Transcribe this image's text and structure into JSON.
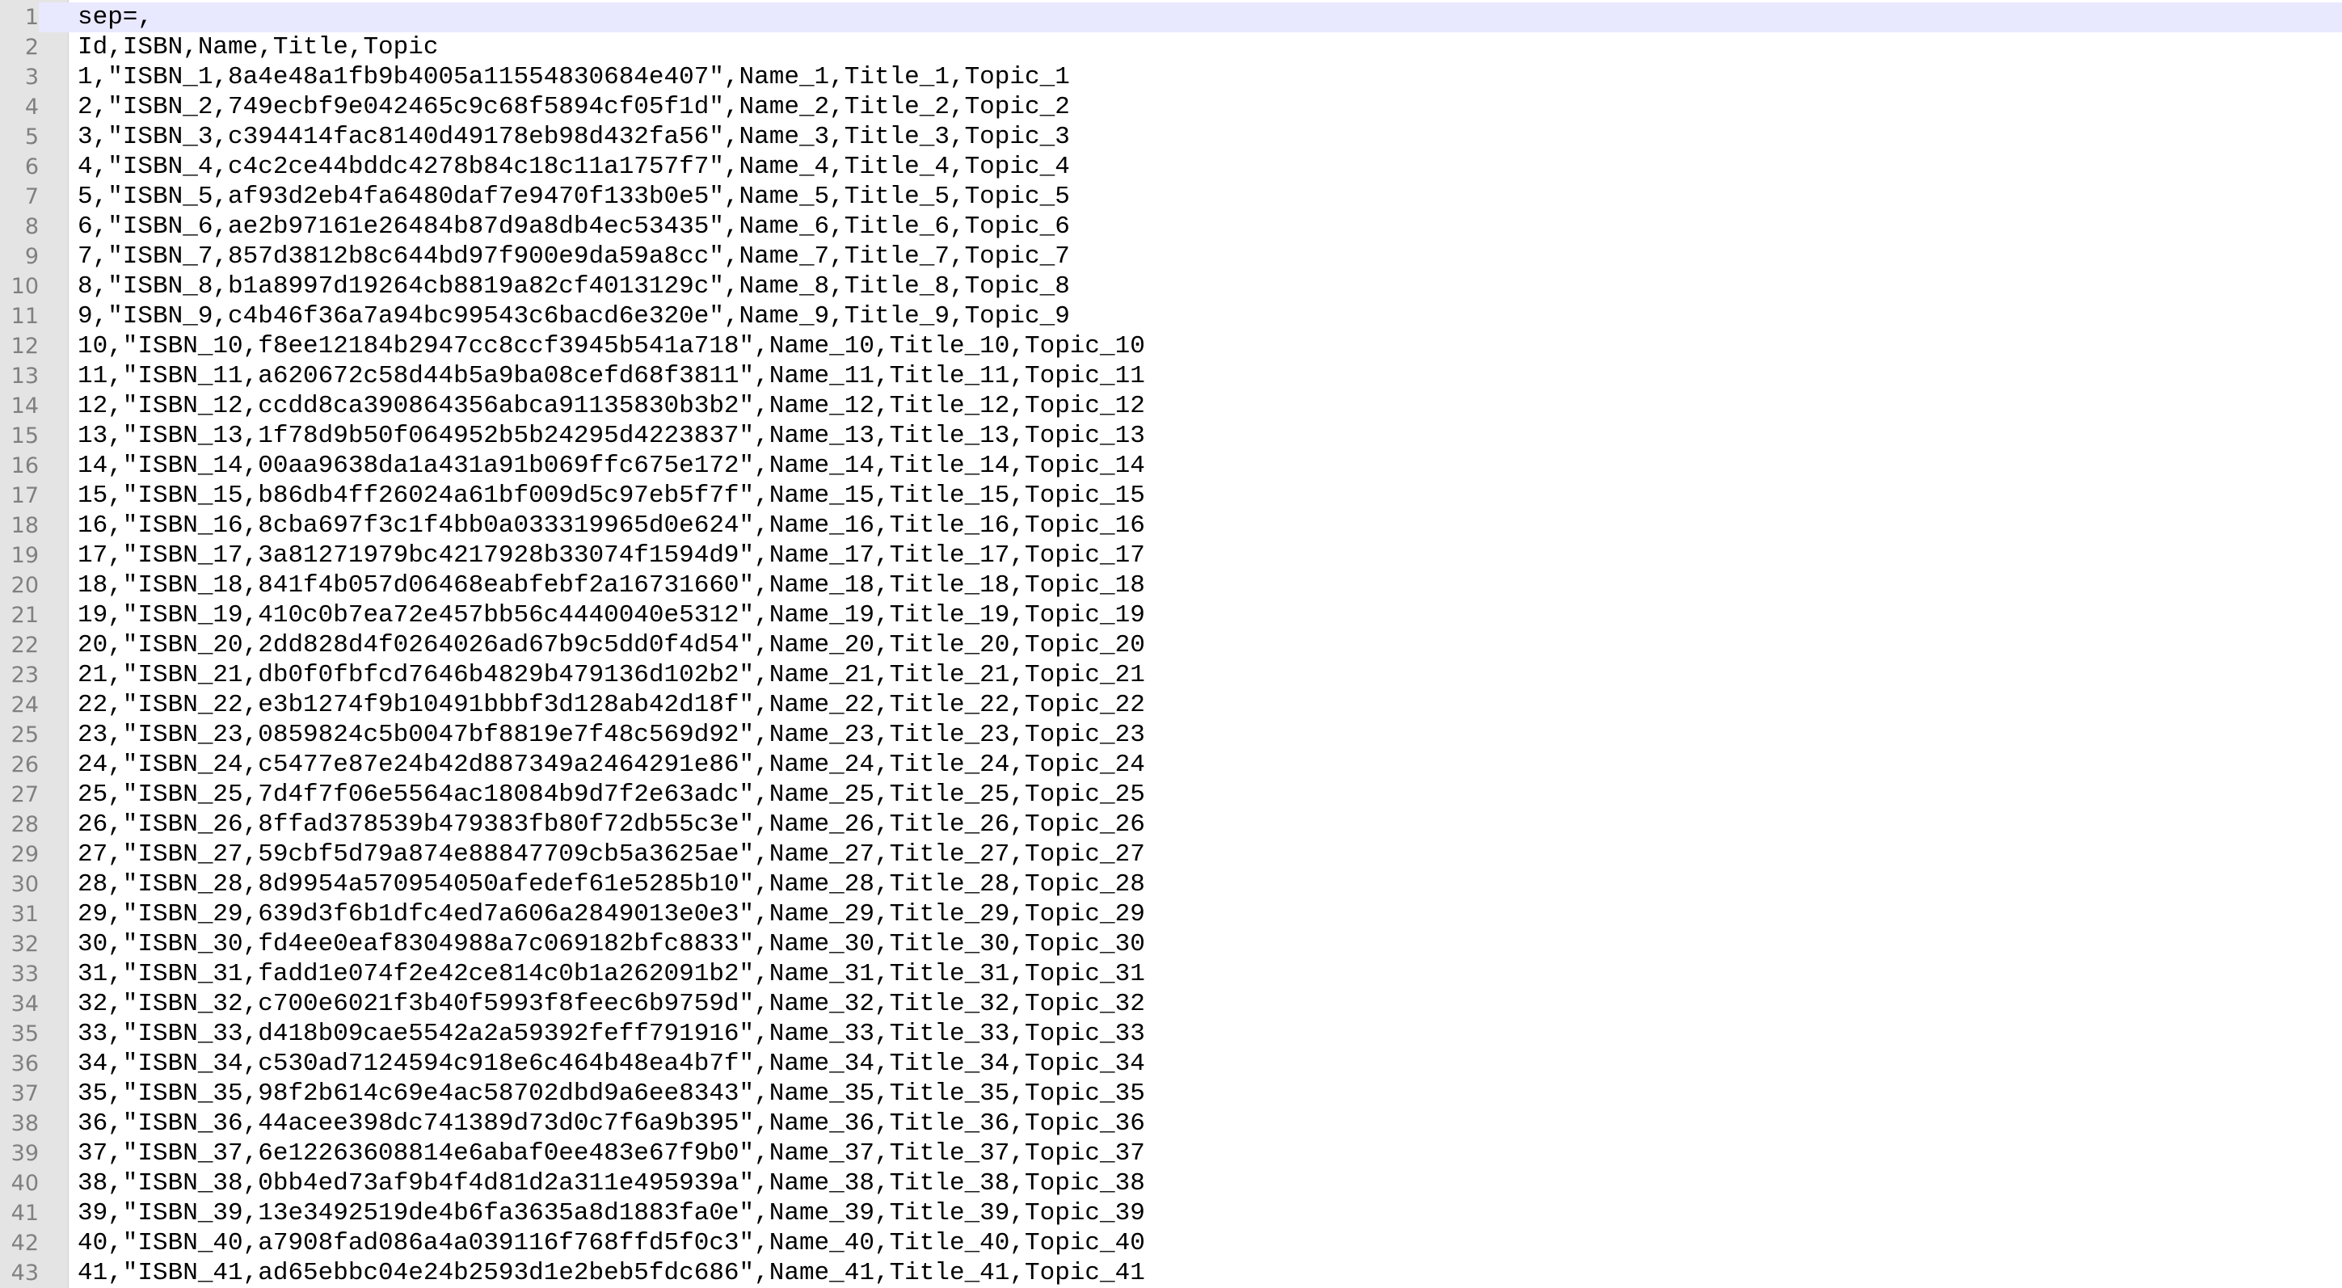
{
  "editor": {
    "current_line": 1,
    "colors": {
      "gutter_bg": "#e4e4e4",
      "current_line_bg": "#e8e8ff",
      "line_number_fg": "#808080",
      "text_fg": "#000000"
    },
    "lines": [
      {
        "n": "1",
        "text": "sep=,"
      },
      {
        "n": "2",
        "text": "Id,ISBN,Name,Title,Topic"
      },
      {
        "n": "3",
        "text": "1,\"ISBN_1,8a4e48a1fb9b4005a11554830684e407\",Name_1,Title_1,Topic_1"
      },
      {
        "n": "4",
        "text": "2,\"ISBN_2,749ecbf9e042465c9c68f5894cf05f1d\",Name_2,Title_2,Topic_2"
      },
      {
        "n": "5",
        "text": "3,\"ISBN_3,c394414fac8140d49178eb98d432fa56\",Name_3,Title_3,Topic_3"
      },
      {
        "n": "6",
        "text": "4,\"ISBN_4,c4c2ce44bddc4278b84c18c11a1757f7\",Name_4,Title_4,Topic_4"
      },
      {
        "n": "7",
        "text": "5,\"ISBN_5,af93d2eb4fa6480daf7e9470f133b0e5\",Name_5,Title_5,Topic_5"
      },
      {
        "n": "8",
        "text": "6,\"ISBN_6,ae2b97161e26484b87d9a8db4ec53435\",Name_6,Title_6,Topic_6"
      },
      {
        "n": "9",
        "text": "7,\"ISBN_7,857d3812b8c644bd97f900e9da59a8cc\",Name_7,Title_7,Topic_7"
      },
      {
        "n": "10",
        "text": "8,\"ISBN_8,b1a8997d19264cb8819a82cf4013129c\",Name_8,Title_8,Topic_8"
      },
      {
        "n": "11",
        "text": "9,\"ISBN_9,c4b46f36a7a94bc99543c6bacd6e320e\",Name_9,Title_9,Topic_9"
      },
      {
        "n": "12",
        "text": "10,\"ISBN_10,f8ee12184b2947cc8ccf3945b541a718\",Name_10,Title_10,Topic_10"
      },
      {
        "n": "13",
        "text": "11,\"ISBN_11,a620672c58d44b5a9ba08cefd68f3811\",Name_11,Title_11,Topic_11"
      },
      {
        "n": "14",
        "text": "12,\"ISBN_12,ccdd8ca390864356abca91135830b3b2\",Name_12,Title_12,Topic_12"
      },
      {
        "n": "15",
        "text": "13,\"ISBN_13,1f78d9b50f064952b5b24295d4223837\",Name_13,Title_13,Topic_13"
      },
      {
        "n": "16",
        "text": "14,\"ISBN_14,00aa9638da1a431a91b069ffc675e172\",Name_14,Title_14,Topic_14"
      },
      {
        "n": "17",
        "text": "15,\"ISBN_15,b86db4ff26024a61bf009d5c97eb5f7f\",Name_15,Title_15,Topic_15"
      },
      {
        "n": "18",
        "text": "16,\"ISBN_16,8cba697f3c1f4bb0a033319965d0e624\",Name_16,Title_16,Topic_16"
      },
      {
        "n": "19",
        "text": "17,\"ISBN_17,3a81271979bc4217928b33074f1594d9\",Name_17,Title_17,Topic_17"
      },
      {
        "n": "20",
        "text": "18,\"ISBN_18,841f4b057d06468eabfebf2a16731660\",Name_18,Title_18,Topic_18"
      },
      {
        "n": "21",
        "text": "19,\"ISBN_19,410c0b7ea72e457bb56c4440040e5312\",Name_19,Title_19,Topic_19"
      },
      {
        "n": "22",
        "text": "20,\"ISBN_20,2dd828d4f0264026ad67b9c5dd0f4d54\",Name_20,Title_20,Topic_20"
      },
      {
        "n": "23",
        "text": "21,\"ISBN_21,db0f0fbfcd7646b4829b479136d102b2\",Name_21,Title_21,Topic_21"
      },
      {
        "n": "24",
        "text": "22,\"ISBN_22,e3b1274f9b10491bbbf3d128ab42d18f\",Name_22,Title_22,Topic_22"
      },
      {
        "n": "25",
        "text": "23,\"ISBN_23,0859824c5b0047bf8819e7f48c569d92\",Name_23,Title_23,Topic_23"
      },
      {
        "n": "26",
        "text": "24,\"ISBN_24,c5477e87e24b42d887349a2464291e86\",Name_24,Title_24,Topic_24"
      },
      {
        "n": "27",
        "text": "25,\"ISBN_25,7d4f7f06e5564ac18084b9d7f2e63adc\",Name_25,Title_25,Topic_25"
      },
      {
        "n": "28",
        "text": "26,\"ISBN_26,8ffad378539b479383fb80f72db55c3e\",Name_26,Title_26,Topic_26"
      },
      {
        "n": "29",
        "text": "27,\"ISBN_27,59cbf5d79a874e88847709cb5a3625ae\",Name_27,Title_27,Topic_27"
      },
      {
        "n": "30",
        "text": "28,\"ISBN_28,8d9954a570954050afedef61e5285b10\",Name_28,Title_28,Topic_28"
      },
      {
        "n": "31",
        "text": "29,\"ISBN_29,639d3f6b1dfc4ed7a606a2849013e0e3\",Name_29,Title_29,Topic_29"
      },
      {
        "n": "32",
        "text": "30,\"ISBN_30,fd4ee0eaf8304988a7c069182bfc8833\",Name_30,Title_30,Topic_30"
      },
      {
        "n": "33",
        "text": "31,\"ISBN_31,fadd1e074f2e42ce814c0b1a262091b2\",Name_31,Title_31,Topic_31"
      },
      {
        "n": "34",
        "text": "32,\"ISBN_32,c700e6021f3b40f5993f8feec6b9759d\",Name_32,Title_32,Topic_32"
      },
      {
        "n": "35",
        "text": "33,\"ISBN_33,d418b09cae5542a2a59392feff791916\",Name_33,Title_33,Topic_33"
      },
      {
        "n": "36",
        "text": "34,\"ISBN_34,c530ad7124594c918e6c464b48ea4b7f\",Name_34,Title_34,Topic_34"
      },
      {
        "n": "37",
        "text": "35,\"ISBN_35,98f2b614c69e4ac58702dbd9a6ee8343\",Name_35,Title_35,Topic_35"
      },
      {
        "n": "38",
        "text": "36,\"ISBN_36,44acee398dc741389d73d0c7f6a9b395\",Name_36,Title_36,Topic_36"
      },
      {
        "n": "39",
        "text": "37,\"ISBN_37,6e12263608814e6abaf0ee483e67f9b0\",Name_37,Title_37,Topic_37"
      },
      {
        "n": "40",
        "text": "38,\"ISBN_38,0bb4ed73af9b4f4d81d2a311e495939a\",Name_38,Title_38,Topic_38"
      },
      {
        "n": "41",
        "text": "39,\"ISBN_39,13e3492519de4b6fa3635a8d1883fa0e\",Name_39,Title_39,Topic_39"
      },
      {
        "n": "42",
        "text": "40,\"ISBN_40,a7908fad086a4a039116f768ffd5f0c3\",Name_40,Title_40,Topic_40"
      },
      {
        "n": "43",
        "text": "41,\"ISBN_41,ad65ebbc04e24b2593d1e2beb5fdc686\",Name_41,Title_41,Topic_41"
      }
    ]
  }
}
